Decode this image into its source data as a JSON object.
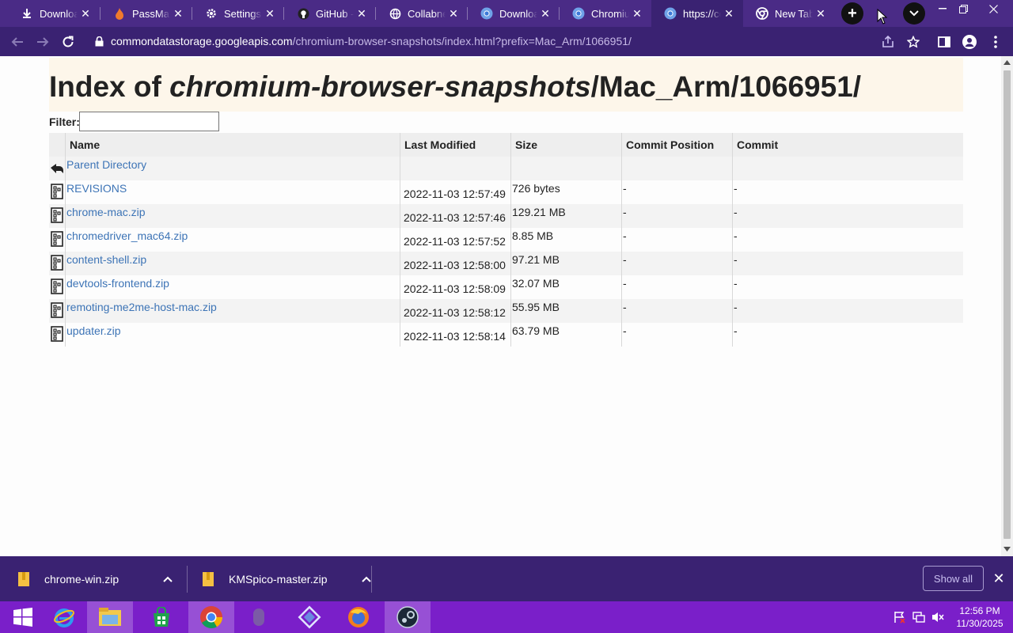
{
  "tabs": [
    {
      "title": "Downloads",
      "icon": "download-icon"
    },
    {
      "title": "PassMark",
      "icon": "flame-icon"
    },
    {
      "title": "Settings - ",
      "icon": "gear-icon"
    },
    {
      "title": "GitHub - ",
      "icon": "github-icon"
    },
    {
      "title": "Collabnet",
      "icon": "globe-icon"
    },
    {
      "title": "Downloads",
      "icon": "chromium-icon"
    },
    {
      "title": "Chromium",
      "icon": "chromium-icon"
    },
    {
      "title": "https://co",
      "icon": "chromium-icon"
    },
    {
      "title": "New Tab",
      "icon": "chrome-icon"
    }
  ],
  "omnibox": {
    "host": "commondatastorage.googleapis.com",
    "path": "/chromium-browser-snapshots/index.html?prefix=Mac_Arm/1066951/"
  },
  "page": {
    "title_prefix": "Index of ",
    "title_italic": "chromium-browser-snapshots",
    "title_suffix": "/Mac_Arm/1066951/",
    "filter_label": "Filter:"
  },
  "table": {
    "headers": [
      "Name",
      "Last Modified",
      "Size",
      "Commit Position",
      "Commit"
    ],
    "parent": "Parent Directory",
    "rows": [
      {
        "name": "REVISIONS",
        "modified": "2022-11-03 12:57:49",
        "size": "726 bytes",
        "position": "-",
        "commit": "-"
      },
      {
        "name": "chrome-mac.zip",
        "modified": "2022-11-03 12:57:46",
        "size": "129.21 MB",
        "position": "-",
        "commit": "-"
      },
      {
        "name": "chromedriver_mac64.zip",
        "modified": "2022-11-03 12:57:52",
        "size": "8.85 MB",
        "position": "-",
        "commit": "-"
      },
      {
        "name": "content-shell.zip",
        "modified": "2022-11-03 12:58:00",
        "size": "97.21 MB",
        "position": "-",
        "commit": "-"
      },
      {
        "name": "devtools-frontend.zip",
        "modified": "2022-11-03 12:58:09",
        "size": "32.07 MB",
        "position": "-",
        "commit": "-"
      },
      {
        "name": "remoting-me2me-host-mac.zip",
        "modified": "2022-11-03 12:58:12",
        "size": "55.95 MB",
        "position": "-",
        "commit": "-"
      },
      {
        "name": "updater.zip",
        "modified": "2022-11-03 12:58:14",
        "size": "63.79 MB",
        "position": "-",
        "commit": "-"
      }
    ]
  },
  "downloads": {
    "items": [
      "chrome-win.zip",
      "KMSpico-master.zip"
    ],
    "show_all": "Show all"
  },
  "taskbar": {
    "time": "12:56 PM",
    "date": "11/30/2025"
  },
  "colors": {
    "accent": "#4a2b86",
    "toolbar": "#3a2272",
    "link": "#3d74b6",
    "taskbar": "#7a1fc9"
  }
}
